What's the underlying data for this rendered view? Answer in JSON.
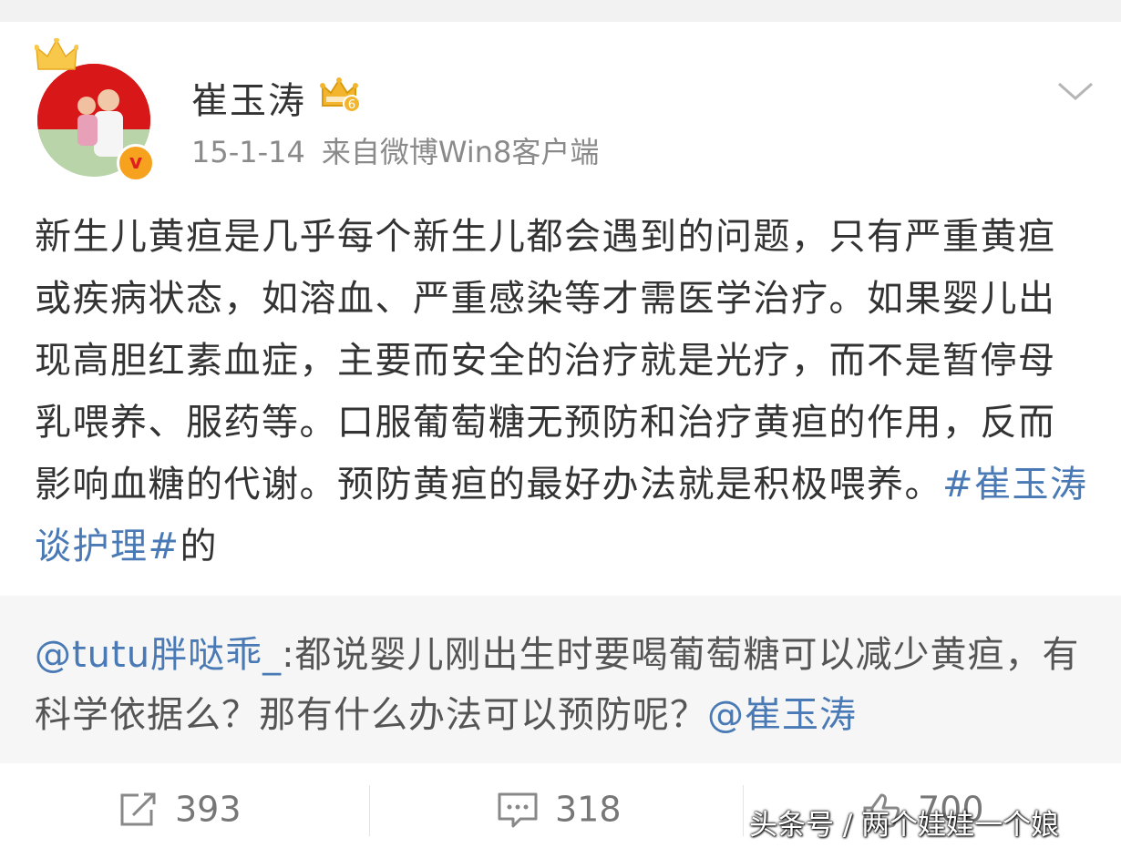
{
  "user": {
    "name": "崔玉涛",
    "vip_level": "6",
    "date": "15-1-14",
    "source": "来自微博Win8客户端"
  },
  "post": {
    "text": "新生儿黄疸是几乎每个新生儿都会遇到的问题，只有严重黄疸或疾病状态，如溶血、严重感染等才需医学治疗。如果婴儿出现高胆红素血症，主要而安全的治疗就是光疗，而不是暂停母乳喂养、服药等。口服葡萄糖无预防和治疗黄疸的作用，反而影响血糖的代谢。预防黄疸的最好办法就是积极喂养。",
    "hashtag": "#崔玉涛谈护理#",
    "suffix": "的"
  },
  "retweet": {
    "author": "@tutu胖哒乖_",
    "text": ":都说婴儿刚出生时要喝葡萄糖可以减少黄疸，有科学依据么？那有什么办法可以预防呢？",
    "mention": "@崔玉涛"
  },
  "actions": {
    "repost_count": "393",
    "comment_count": "318",
    "like_count": "700"
  },
  "watermark": "头条号 / 两个娃娃一个娘",
  "colors": {
    "link": "#4a7ab5",
    "text": "#333333",
    "meta": "#8a8a8a",
    "badge": "#f6a21e"
  }
}
